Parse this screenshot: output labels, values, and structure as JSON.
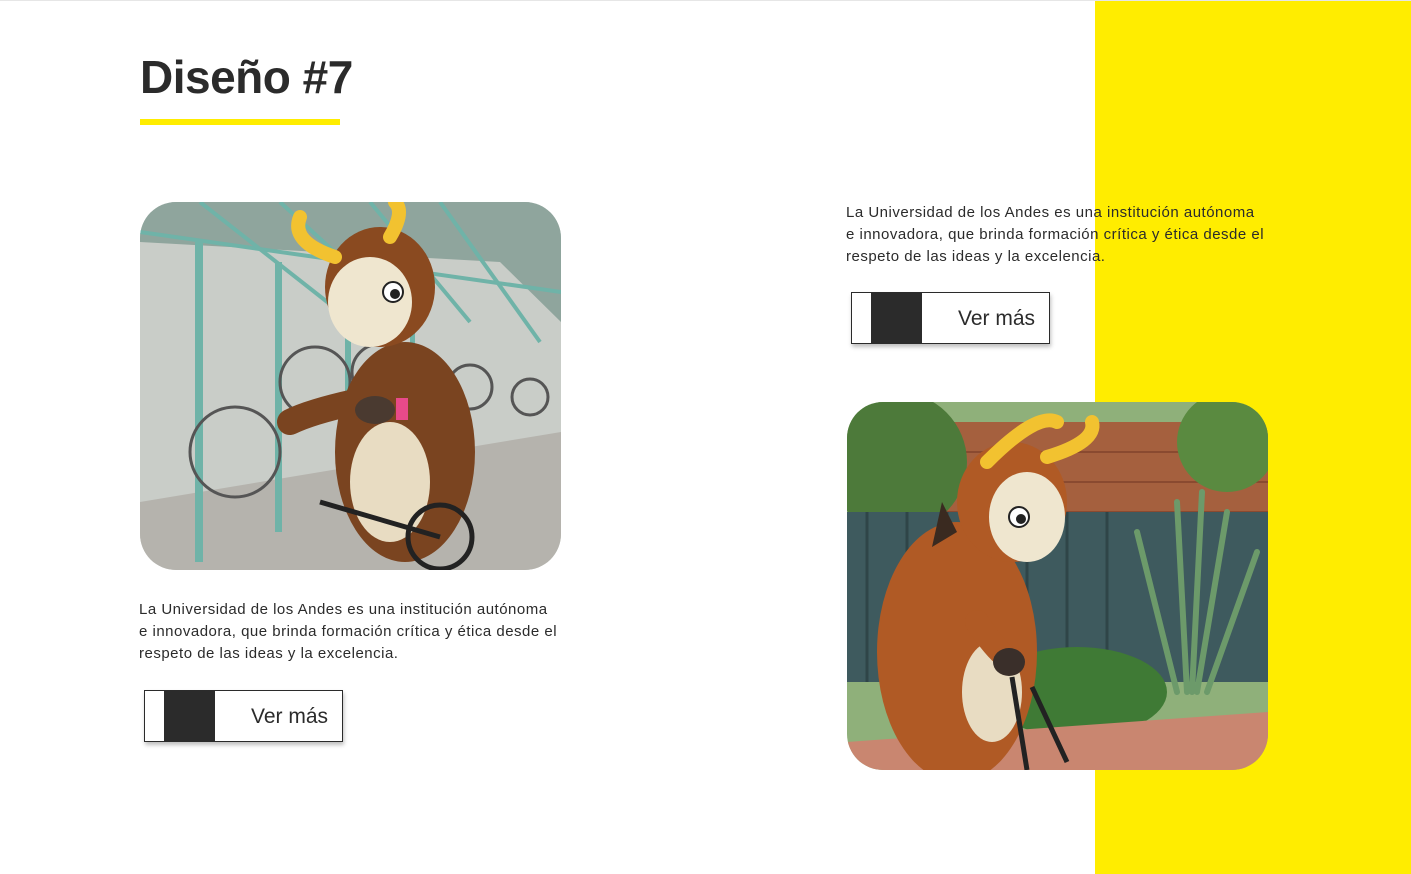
{
  "header": {
    "title": "Diseño #7"
  },
  "cards": [
    {
      "description": "La Universidad de los Andes es una institución autónoma e innovadora, que brinda formación crítica y ética desde el respeto de las ideas y la excelencia.",
      "button_label": "Ver más",
      "image_icon": "mascot-on-bicycle-photo"
    },
    {
      "description": "La Universidad de los Andes es una institución autónoma e innovadora, que brinda formación crítica y ética desde el respeto de las ideas y la excelencia.",
      "button_label": "Ver más",
      "image_icon": "mascot-walking-photo"
    }
  ],
  "colors": {
    "accent": "#ffed00",
    "text": "#2b2b2b",
    "background": "#ffffff"
  }
}
